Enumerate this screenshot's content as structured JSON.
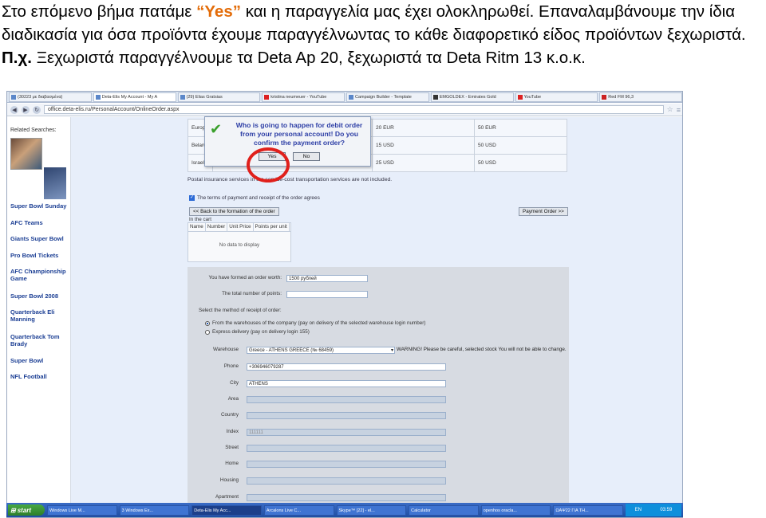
{
  "caption": {
    "part1": "Στο επόμενο βήμα πατάμε ",
    "highlight": "“Yes”",
    "part2": " και η παραγγελία μας έχει ολοκληρωθεί. Επαναλαμβάνουμε την ίδια διαδικασία για όσα προϊόντα έχουμε παραγγέλνωντας το κάθε διαφορετικό είδος προϊόντων ξεχωριστά. ",
    "bold": "Π.χ.",
    "part3": " Ξεχωριστά παραγγέλνουμε τα Deta Ap 20, ξεχωριστά τα Deta Ritm 13 κ.ο.κ."
  },
  "browser": {
    "tabs": [
      {
        "label": "(30223 με διαβασμένα)"
      },
      {
        "label": "Deta-Elis My Account - My A"
      },
      {
        "label": "(29) Elias Gratsias"
      },
      {
        "label": "kristina neumeuer - YouTube"
      },
      {
        "label": "Campaign Builder - Template"
      },
      {
        "label": "EMGOLDEX - Emirates Gold"
      },
      {
        "label": "YouTube"
      },
      {
        "label": "Red FM 96,3"
      }
    ],
    "url": "office.deta-elis.ru/PersonalAccount/OnlineOrder.aspx"
  },
  "sidebar": {
    "header": "Related Searches:",
    "links": [
      "Super Bowl Sunday",
      "AFC Teams",
      "Giants Super Bowl",
      "Pro Bowl Tickets",
      "AFC Championship Game",
      "Super Bowl 2008",
      "Quarterback Eli Manning",
      "Quarterback Tom Brady",
      "Super Bowl",
      "NFL Football"
    ]
  },
  "rates": [
    {
      "country": "Europe",
      "a": "20 EUR",
      "b": "50 EUR"
    },
    {
      "country": "Belarus",
      "a": "15 USD",
      "b": "50 USD"
    },
    {
      "country": "Israel",
      "a": "25 USD",
      "b": "50 USD"
    }
  ],
  "insurance_note": "Postal insurance services in the service-cost transportation services are not included.",
  "terms_label": "The terms of payment and receipt of the order agrees",
  "back_button": "<< Back to the formation of the order",
  "payment_button": "Payment Order >>",
  "cart": {
    "title": "In the cart",
    "columns": [
      "Name",
      "Number",
      "Unit Price",
      "Points per unit"
    ],
    "empty": "No data to display"
  },
  "form": {
    "worth_label": "You have formed an order worth:",
    "worth_value": "1500 рублей",
    "points_label": "The total number of points:",
    "points_value": "",
    "method_label": "Select the method of receipt of order:",
    "option1": "From the warehouses of the company (pay on delivery of the selected warehouse login number)",
    "option2": "Express delivery (pay on delivery login 155)",
    "warehouse_label": "Warehouse",
    "warehouse_value": "Greece - ATHENS GREECE (№ 68459)",
    "warning": "WARNING! Please be careful, selected stock You will not be able to change.",
    "phone_label": "Phone",
    "phone_value": "+306946079287",
    "city_label": "City",
    "city_value": "ATHENS",
    "area_label": "Area",
    "country_label": "Country",
    "index_label": "Index",
    "index_placeholder": "111111",
    "street_label": "Street",
    "home_label": "Home",
    "housing_label": "Housing",
    "apartment_label": "Apartment"
  },
  "dialog": {
    "message": "Who is going to happen for debit order from your personal account! Do you confirm the payment order?",
    "yes": "Yes",
    "no": "No"
  },
  "taskbar": {
    "start": "start",
    "items": [
      "Windows Live M...",
      "3 Windows Ex...",
      "Deta-Elis My Acc...",
      "Arcalons Live C...",
      "Skype™ [22] - el...",
      "Calculator",
      "openhos oracla...",
      "ΩAΨ22 ΓΙΑ ΤΗ...",
      "EN"
    ],
    "clock": "03:59"
  }
}
